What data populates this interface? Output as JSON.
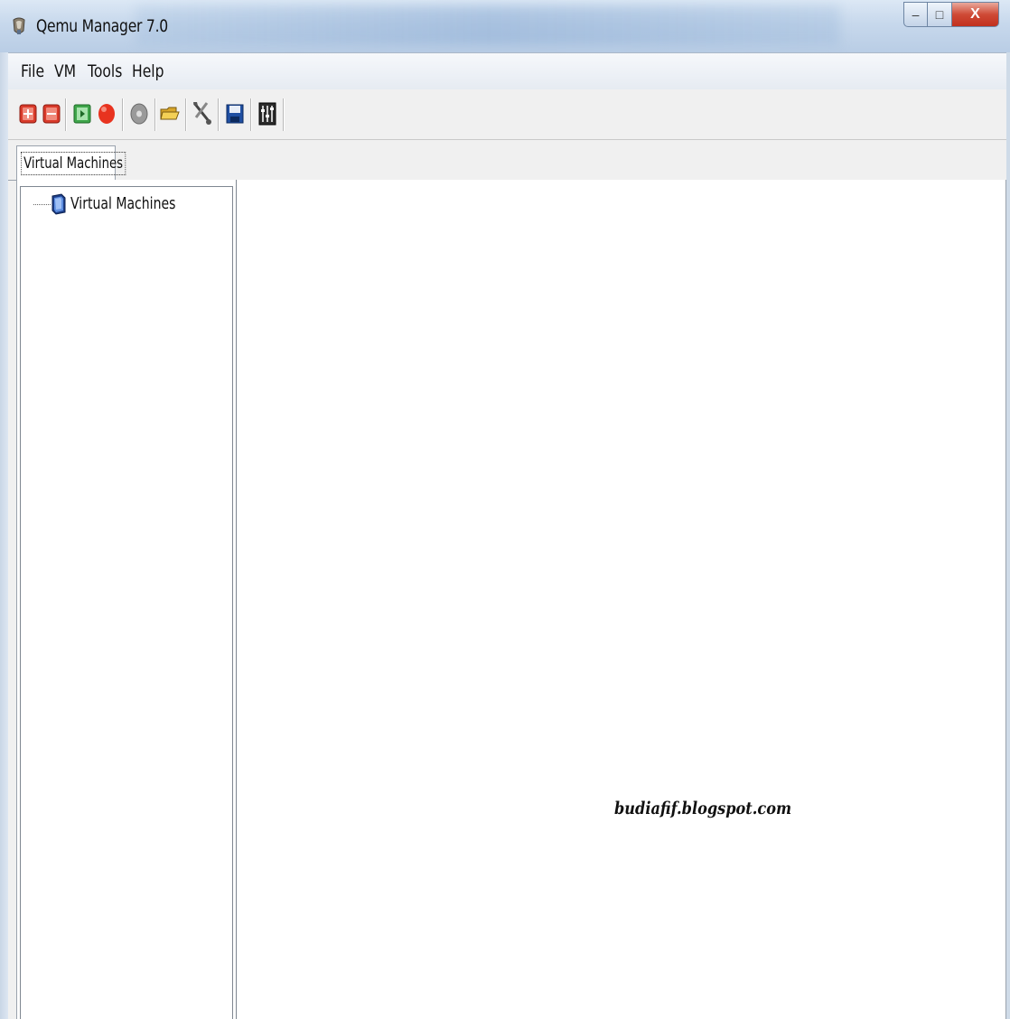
{
  "window": {
    "title": "Qemu Manager 7.0",
    "controls": {
      "minimize": "–",
      "maximize": "□",
      "close": "X"
    }
  },
  "menu": [
    "File",
    "VM",
    "Tools",
    "Help"
  ],
  "toolbar": {
    "icons": [
      "add-vm-icon",
      "remove-vm-icon",
      "start-vm-icon",
      "stop-vm-icon",
      "cd-disc-icon",
      "open-folder-icon",
      "tools-icon",
      "save-icon",
      "settings-panel-icon"
    ]
  },
  "tabs": [
    {
      "label": "Virtual Machines",
      "active": true
    }
  ],
  "tree": {
    "root": {
      "label": "Virtual Machines",
      "icon": "vm-group-icon"
    }
  },
  "watermark": "budiafif.blogspot.com",
  "colors": {
    "accent_red": "#d93a2a",
    "accent_green": "#3ea54a",
    "title_blue": "#c7d8ec"
  }
}
